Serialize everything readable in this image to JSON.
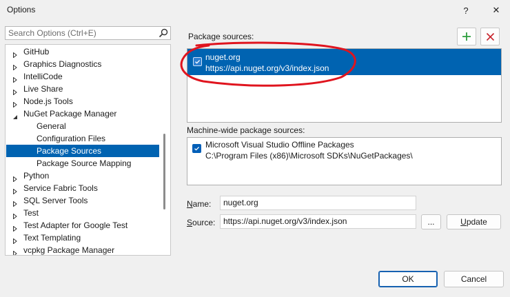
{
  "window": {
    "title": "Options",
    "help_label": "?",
    "close_label": "✕"
  },
  "search": {
    "placeholder": "Search Options (Ctrl+E)"
  },
  "tree": [
    {
      "label": "GitHub",
      "expandable": true,
      "level": 0
    },
    {
      "label": "Graphics Diagnostics",
      "expandable": true,
      "level": 0
    },
    {
      "label": "IntelliCode",
      "expandable": true,
      "level": 0
    },
    {
      "label": "Live Share",
      "expandable": true,
      "level": 0
    },
    {
      "label": "Node.js Tools",
      "expandable": true,
      "level": 0
    },
    {
      "label": "NuGet Package Manager",
      "expandable": true,
      "expanded": true,
      "level": 0
    },
    {
      "label": "General",
      "expandable": false,
      "level": 1
    },
    {
      "label": "Configuration Files",
      "expandable": false,
      "level": 1
    },
    {
      "label": "Package Sources",
      "expandable": false,
      "level": 1,
      "selected": true
    },
    {
      "label": "Package Source Mapping",
      "expandable": false,
      "level": 1
    },
    {
      "label": "Python",
      "expandable": true,
      "level": 0
    },
    {
      "label": "Service Fabric Tools",
      "expandable": true,
      "level": 0
    },
    {
      "label": "SQL Server Tools",
      "expandable": true,
      "level": 0
    },
    {
      "label": "Test",
      "expandable": true,
      "level": 0
    },
    {
      "label": "Test Adapter for Google Test",
      "expandable": true,
      "level": 0
    },
    {
      "label": "Text Templating",
      "expandable": true,
      "level": 0
    },
    {
      "label": "vcpkg Package Manager",
      "expandable": true,
      "level": 0
    }
  ],
  "package_sources": {
    "label": "Package sources:",
    "items": [
      {
        "name": "nuget.org",
        "url": "https://api.nuget.org/v3/index.json",
        "checked": true,
        "selected": true
      }
    ]
  },
  "machine_sources": {
    "label": "Machine-wide package sources:",
    "items": [
      {
        "name": "Microsoft Visual Studio Offline Packages",
        "path": "C:\\Program Files (x86)\\Microsoft SDKs\\NuGetPackages\\",
        "checked": true
      }
    ]
  },
  "form": {
    "name_label_u": "N",
    "name_label_rest": "ame:",
    "name_value": "nuget.org",
    "source_label_u": "S",
    "source_label_rest": "ource:",
    "source_value": "https://api.nuget.org/v3/index.json",
    "browse_label": "...",
    "update_label_u": "U",
    "update_label_rest": "pdate"
  },
  "footer": {
    "ok_label": "OK",
    "cancel_label": "Cancel"
  },
  "colors": {
    "selection": "#0063b1",
    "annotation": "#e0141e",
    "add_icon": "#2e9e3e",
    "remove_icon": "#c8232c"
  }
}
